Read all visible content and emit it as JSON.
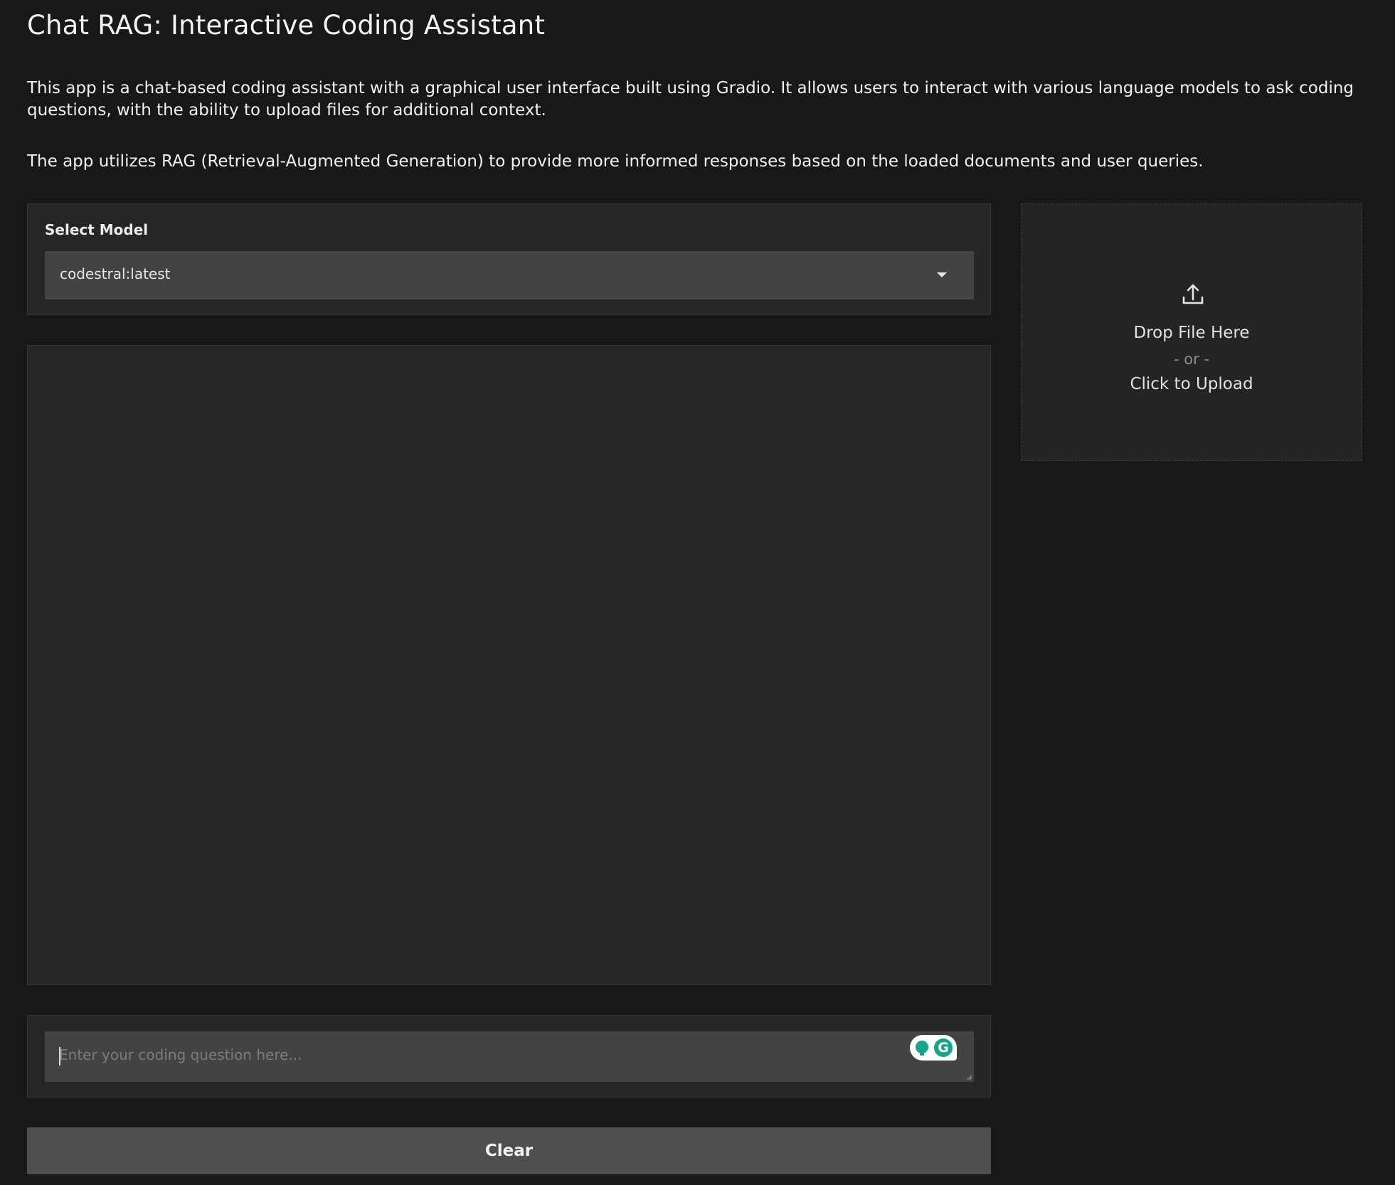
{
  "header": {
    "title": "Chat RAG: Interactive Coding Assistant"
  },
  "description": {
    "paragraph1": "This app is a chat-based coding assistant with a graphical user interface built using Gradio. It allows users to interact with various language models to ask coding questions, with the ability to upload files for additional context.",
    "paragraph2": "The app utilizes RAG (Retrieval-Augmented Generation) to provide more informed responses based on the loaded documents and user queries."
  },
  "model_select": {
    "label": "Select Model",
    "selected": "codestral:latest",
    "icon": "chevron-down-icon"
  },
  "chat": {
    "messages": []
  },
  "upload": {
    "icon": "upload-icon",
    "drop_text": "Drop File Here",
    "or_text": "- or -",
    "click_text": "Click to Upload"
  },
  "question": {
    "value": "",
    "placeholder": "Enter your coding question here...",
    "extension_icon": "grammarly-icon",
    "extension_color": "#14a58a"
  },
  "actions": {
    "clear_label": "Clear"
  }
}
